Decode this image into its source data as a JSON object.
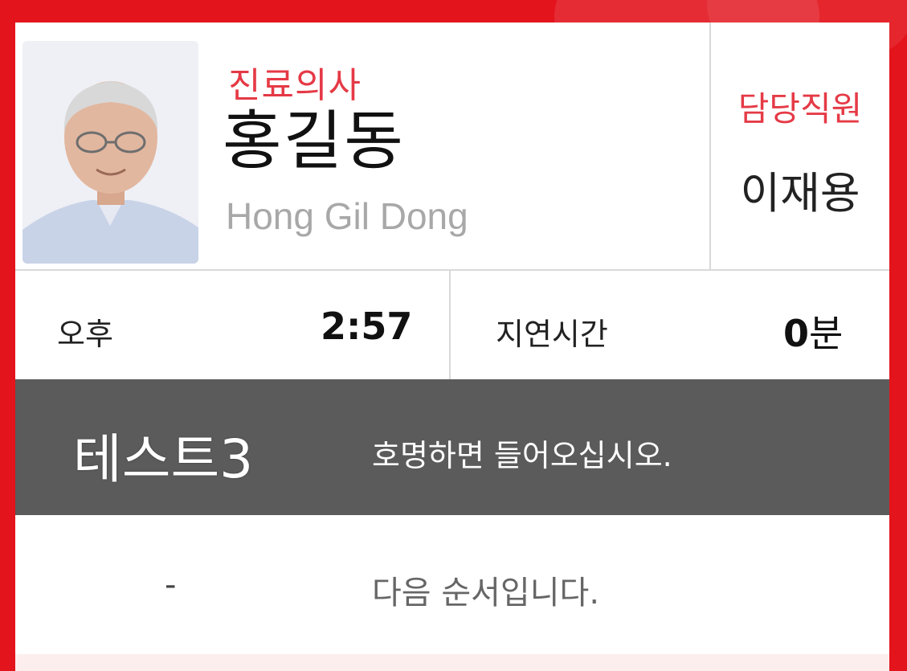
{
  "doctor": {
    "role_label": "진료의사",
    "name": "홍길동",
    "name_en": "Hong Gil Dong"
  },
  "staff": {
    "label": "담당직원",
    "name": "이재용"
  },
  "time": {
    "ampm": "오후",
    "clock": "2:57"
  },
  "delay": {
    "label": "지연시간",
    "value": "0",
    "unit": "분"
  },
  "current": {
    "patient": "테스트3",
    "message": "호명하면 들어오십시오."
  },
  "next": {
    "patient": "-",
    "message": "다음 순서입니다."
  },
  "colors": {
    "frame": "#e3141c",
    "accent_label": "#e53a46",
    "current_bar": "#5b5b5b"
  }
}
